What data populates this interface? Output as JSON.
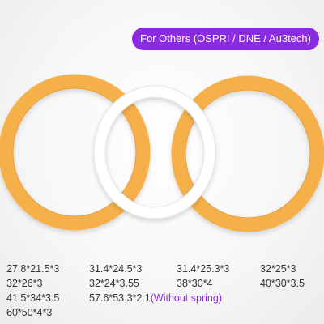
{
  "badge": {
    "text": "For Others (OSPRI / DNE / Au3tech)"
  },
  "colors": {
    "accent": "#8a2be2",
    "ring_orange": "#f5b04a",
    "ring_white": "#ffffff"
  },
  "rings": [
    "orange-ring",
    "white-ring",
    "orange-ring"
  ],
  "sizes": [
    "27.8*21.5*3",
    "31.4*24.5*3",
    "31.4*25.3*3",
    "32*25*3",
    "32*26*3",
    "32*24*3.55",
    "38*30*4",
    "40*30*3.5",
    "41.5*34*3.5",
    "57.6*53.3*2.1",
    "60*50*4*3"
  ],
  "note": "(Without spring)"
}
